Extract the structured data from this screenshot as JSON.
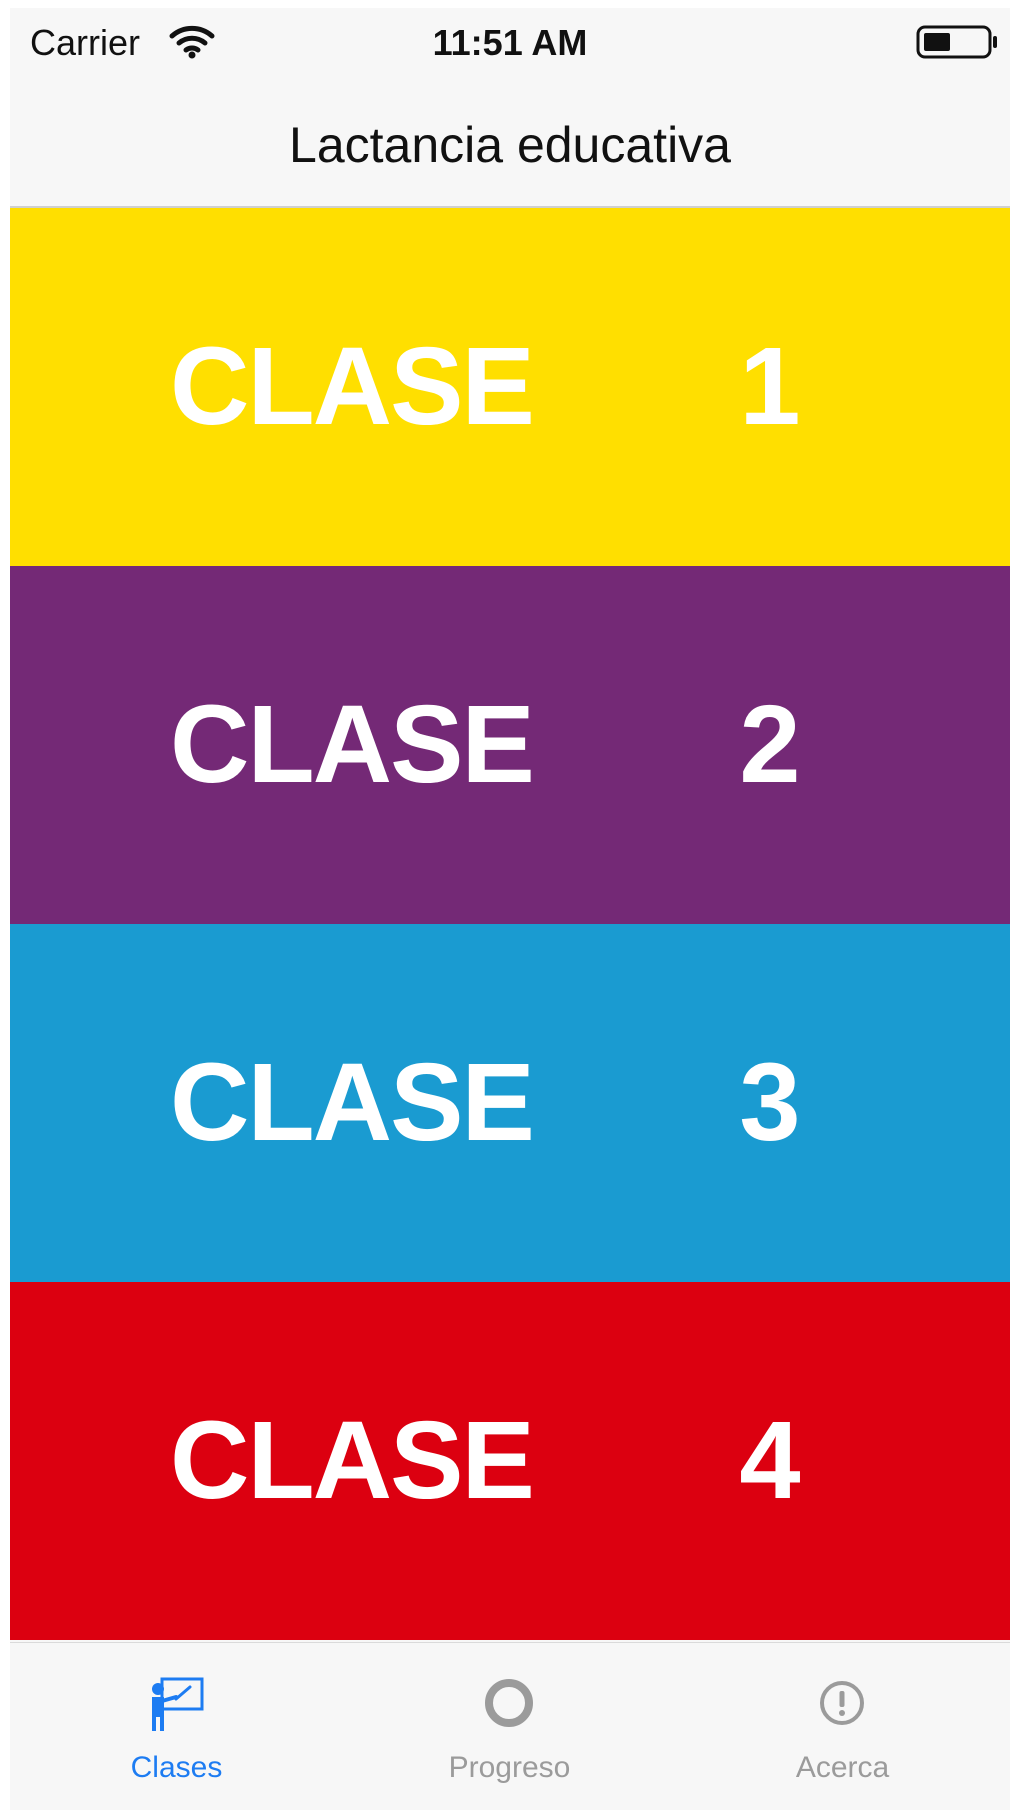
{
  "status_bar": {
    "carrier": "Carrier",
    "time": "11:51 AM",
    "icons": [
      "wifi-icon",
      "battery-icon"
    ]
  },
  "nav": {
    "title": "Lactancia educativa"
  },
  "classes": [
    {
      "label": "CLASE",
      "number": "1",
      "color": "#FFDF00"
    },
    {
      "label": "CLASE",
      "number": "2",
      "color": "#742976"
    },
    {
      "label": "CLASE",
      "number": "3",
      "color": "#1A9BD1"
    },
    {
      "label": "CLASE",
      "number": "4",
      "color": "#DC0010"
    }
  ],
  "tab_bar": {
    "active_color": "#1D7CF2",
    "inactive_color": "#9B9B9B",
    "tabs": [
      {
        "label": "Clases",
        "icon": "teacher-board-icon",
        "active": true
      },
      {
        "label": "Progreso",
        "icon": "circle-icon",
        "active": false
      },
      {
        "label": "Acerca",
        "icon": "info-exclamation-icon",
        "active": false
      }
    ]
  }
}
